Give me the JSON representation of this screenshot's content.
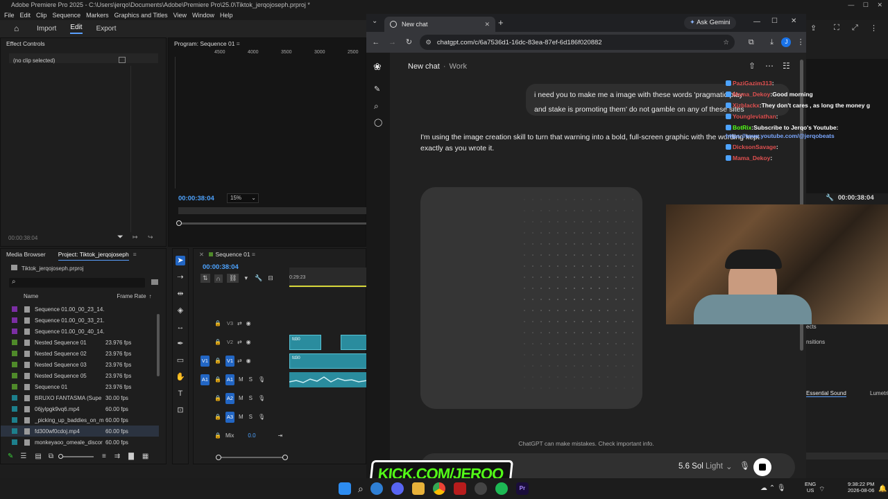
{
  "premiere": {
    "title": "Adobe Premiere Pro 2025 - C:\\Users\\jerqo\\Documents\\Adobe\\Premiere Pro\\25.0\\Tiktok_jerqojoseph.prproj *",
    "menu": [
      "File",
      "Edit",
      "Clip",
      "Sequence",
      "Markers",
      "Graphics and Titles",
      "View",
      "Window",
      "Help"
    ],
    "workspaces": {
      "import": "Import",
      "edit": "Edit",
      "export": "Export"
    },
    "effect_controls": {
      "title": "Effect Controls",
      "empty": "(no clip selected)",
      "time": "00:00:38:04"
    },
    "program": {
      "title": "Program: Sequence 01",
      "ruler": [
        "4500",
        "4000",
        "3500",
        "3000",
        "2500"
      ],
      "timecode": "00:00:38:04",
      "zoom": "15%"
    },
    "project": {
      "tab_media": "Media Browser",
      "tab_project": "Project: Tiktok_jerqojoseph",
      "file": "Tiktok_jerqojoseph.prproj",
      "col_name": "Name",
      "col_rate": "Frame Rate",
      "rows": [
        {
          "name": "Sequence 01.00_00_23_14.S",
          "rate": "",
          "color": "#7b2ea3"
        },
        {
          "name": "Sequence 01.00_00_33_21.S",
          "rate": "",
          "color": "#7b2ea3"
        },
        {
          "name": "Sequence 01.00_00_40_14.S",
          "rate": "",
          "color": "#7b2ea3"
        },
        {
          "name": "Nested Sequence 01",
          "rate": "23.976 fps",
          "color": "#4f8a2a"
        },
        {
          "name": "Nested Sequence 02",
          "rate": "23.976 fps",
          "color": "#4f8a2a"
        },
        {
          "name": "Nested Sequence 03",
          "rate": "23.976 fps",
          "color": "#4f8a2a"
        },
        {
          "name": "Nested Sequence 05",
          "rate": "23.976 fps",
          "color": "#4f8a2a"
        },
        {
          "name": "Sequence 01",
          "rate": "23.976 fps",
          "color": "#4f8a2a"
        },
        {
          "name": "BRUXO FANTASMA (Supe",
          "rate": "30.00 fps",
          "color": "#1d7f8c"
        },
        {
          "name": "06jylpgk9vq6.mp4",
          "rate": "60.00 fps",
          "color": "#1d7f8c"
        },
        {
          "name": "_picking_up_baddies_on_m",
          "rate": "60.00 fps",
          "color": "#1d7f8c"
        },
        {
          "name": "fd300wf0cdoj.mp4",
          "rate": "60.00 fps",
          "color": "#1d7f8c"
        },
        {
          "name": "monkeyaoo_omeale_discor",
          "rate": "60.00 fps",
          "color": "#1d7f8c"
        }
      ]
    },
    "timeline": {
      "title": "Sequence 01",
      "timecode": "00:00:38:04",
      "ruler_time": "0:29:23",
      "tracks_video": [
        "V3",
        "V2",
        "V1"
      ],
      "tracks_audio": [
        "A1",
        "A2",
        "A3"
      ],
      "mix_label": "Mix",
      "mix_value": "0.0",
      "clip_label": "fd30"
    },
    "right_panel": {
      "timecode": "00:00:38:04",
      "fragments": [
        "ects",
        "nsitions"
      ],
      "tab_sound": "Essential Sound",
      "tab_lumetri": "Lumetri"
    }
  },
  "chrome": {
    "tab_title": "New chat",
    "ask_gemini": "Ask Gemini",
    "url": "chatgpt.com/c/6a7536d1-16dc-83ea-87ef-6d186f020882",
    "profile_initial": "J"
  },
  "chatgpt": {
    "breadcrumb_new": "New chat",
    "breadcrumb_sep": "·",
    "breadcrumb_project": "Work",
    "user_message_line1": "i need you to make me a image with these words 'pragmatic play",
    "user_message_line2": "and stake is promoting them' do not gamble on any of these sites",
    "assistant_line1": "I'm using the image creation skill to turn that warning into a bold, full-screen graphic with the wording kept",
    "assistant_line2": "exactly as you wrote it.",
    "disclaimer": "ChatGPT can make mistakes. Check important info.",
    "model": "5.6 Sol",
    "model_mode": "Light"
  },
  "stream_chat": [
    {
      "user": "PaziGazim313",
      "text": "",
      "color": "#e05050"
    },
    {
      "user": "Mama_Dekoy",
      "text": "Good morning",
      "color": "#e05050"
    },
    {
      "user": "Xjzblackx",
      "text": "They don't cares , as long the money g",
      "color": "#e05050"
    },
    {
      "user": "Youngleviathan",
      "text": "",
      "color": "#e05050"
    },
    {
      "user": "BotRix",
      "text": "Subscribe to Jerqo's Youtube:",
      "color": "#53fc18"
    },
    {
      "user": "",
      "text": "https://www.youtube.com/@jerqobeats",
      "color": "#7aa7ff"
    },
    {
      "user": "DicksonSavage",
      "text": "",
      "color": "#e05050"
    },
    {
      "user": "Mama_Dekoy",
      "text": "",
      "color": "#e05050"
    }
  ],
  "overlay": {
    "kick": "KICK.COM/JERQO"
  },
  "taskbar": {
    "lang1": "ENG",
    "lang2": "US",
    "time": "9:38:22 PM",
    "date": "2026-08-06",
    "pr_label": "Pr"
  },
  "colors": {
    "accent": "#2266c4",
    "kick": "#53fc18",
    "clip": "#2a8c9e"
  }
}
